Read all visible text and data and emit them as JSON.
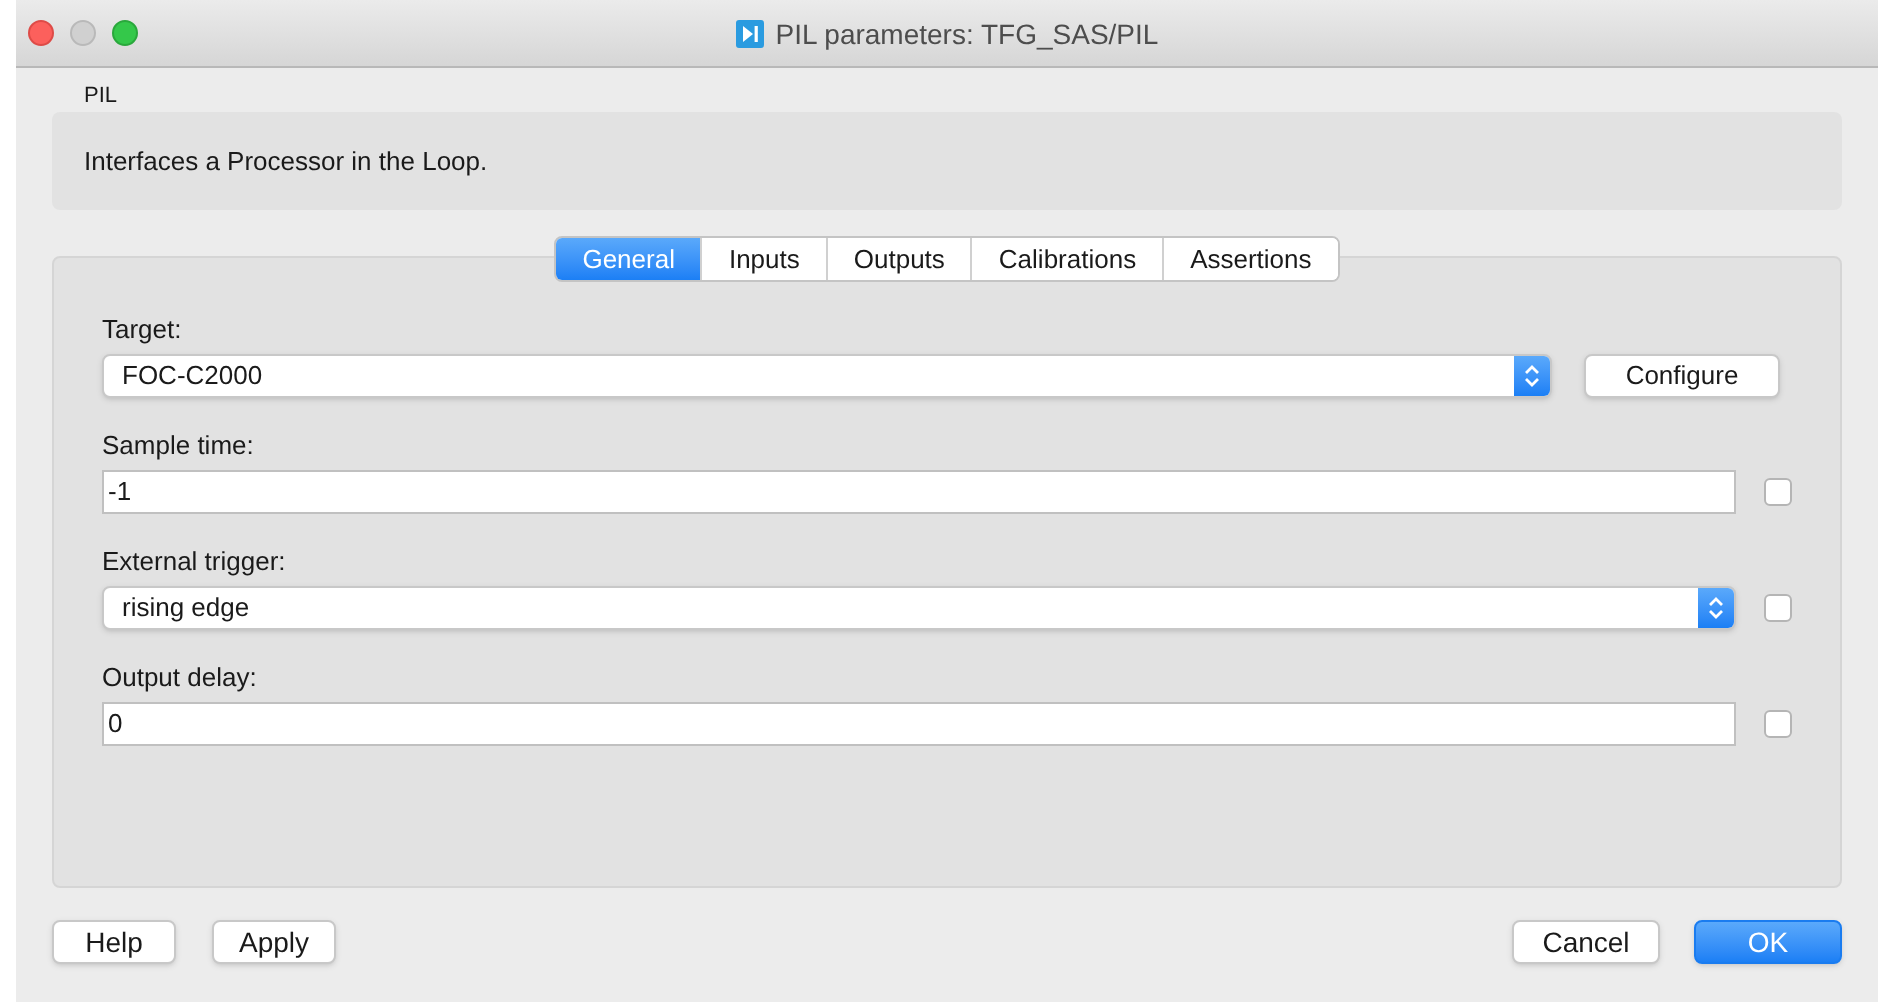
{
  "window": {
    "title": "PIL parameters: TFG_SAS/PIL"
  },
  "block_name": "PIL",
  "description": "Interfaces a Processor in the Loop.",
  "tabs": [
    {
      "label": "General",
      "selected": true
    },
    {
      "label": "Inputs",
      "selected": false
    },
    {
      "label": "Outputs",
      "selected": false
    },
    {
      "label": "Calibrations",
      "selected": false
    },
    {
      "label": "Assertions",
      "selected": false
    }
  ],
  "parameters": [
    {
      "kind": "select",
      "label": "Target:",
      "value": "FOC-C2000",
      "button": "Configure"
    },
    {
      "kind": "text",
      "label": "Sample time:",
      "value": "-1",
      "checked": false
    },
    {
      "kind": "select",
      "label": "External trigger:",
      "value": "rising edge",
      "checked": false
    },
    {
      "kind": "text",
      "label": "Output delay:",
      "value": "0",
      "checked": false
    }
  ],
  "buttons_left": [
    "Help",
    "Apply"
  ],
  "buttons_right": [
    {
      "label": "Cancel",
      "default": false
    },
    {
      "label": "OK",
      "default": true
    }
  ]
}
